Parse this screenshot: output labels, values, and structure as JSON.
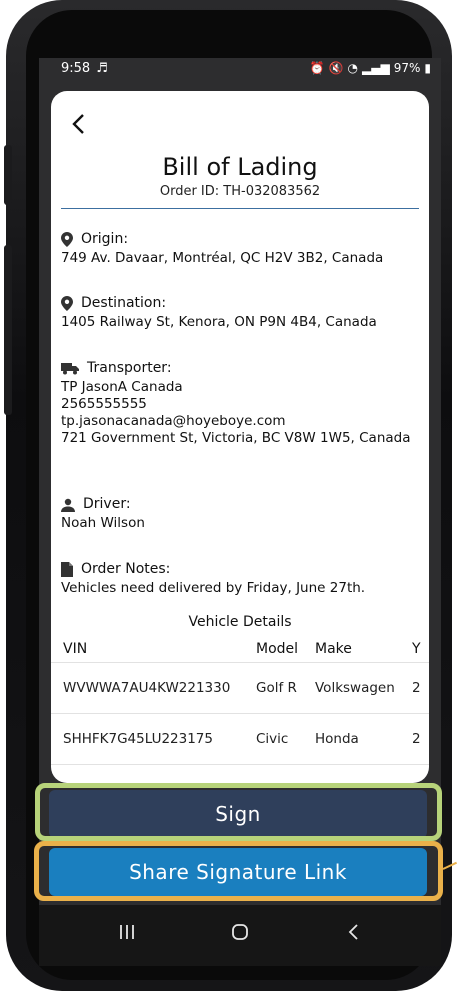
{
  "status": {
    "time": "9:58",
    "battery": "97%"
  },
  "header": {
    "title": "Bill of Lading",
    "order_id": "Order ID: TH-032083562"
  },
  "origin": {
    "label": "Origin:",
    "value": "749 Av. Davaar, Montréal, QC H2V 3B2, Canada"
  },
  "destination": {
    "label": "Destination:",
    "value": "1405 Railway St, Kenora, ON P9N 4B4, Canada"
  },
  "transporter": {
    "label": "Transporter:",
    "name": "TP JasonA Canada",
    "phone": "2565555555",
    "email": "tp.jasonacanada@hoyeboye.com",
    "address": "721 Government St, Victoria, BC V8W 1W5, Canada"
  },
  "driver": {
    "label": "Driver:",
    "name": "Noah Wilson"
  },
  "notes": {
    "label": "Order Notes:",
    "text": "Vehicles need delivered by Friday, June 27th."
  },
  "vehicle_details": {
    "title": "Vehicle Details",
    "columns": [
      "VIN",
      "Model",
      "Make",
      "Y"
    ],
    "rows": [
      {
        "vin": "WVWWA7AU4KW221330",
        "model": "Golf R",
        "make": "Volkswagen",
        "year": "2"
      },
      {
        "vin": "SHHFK7G45LU223175",
        "model": "Civic",
        "make": "Honda",
        "year": "2"
      }
    ]
  },
  "actions": {
    "sign": "Sign",
    "share": "Share Signature Link"
  },
  "colors": {
    "sign_button": "#2f3f5b",
    "share_button": "#1a7fbf",
    "highlight_green": "#b7d37a",
    "highlight_orange": "#eab14a"
  },
  "icons": [
    "back-icon",
    "location-pin-icon",
    "truck-icon",
    "person-icon",
    "document-icon"
  ]
}
